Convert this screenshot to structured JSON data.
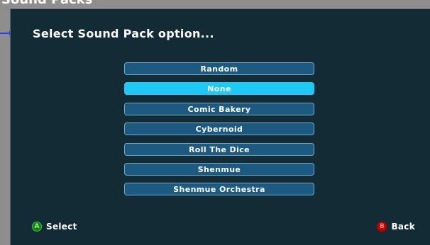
{
  "window": {
    "title": "Sound Packs"
  },
  "panel": {
    "header": "Select Sound Pack option..."
  },
  "options": [
    {
      "label": "Random",
      "selected": false
    },
    {
      "label": "None",
      "selected": true
    },
    {
      "label": "Comic Bakery",
      "selected": false
    },
    {
      "label": "Cybernoid",
      "selected": false
    },
    {
      "label": "Roll The Dice",
      "selected": false
    },
    {
      "label": "Shenmue",
      "selected": false
    },
    {
      "label": "Shenmue Orchestra",
      "selected": false
    }
  ],
  "footer": {
    "select_icon": "A",
    "select_label": "Select",
    "back_icon": "B",
    "back_label": "Back"
  },
  "colors": {
    "panel_bg": "#132b35",
    "option_bg": "#1c5a82",
    "option_selected_bg": "#1ec9f5",
    "a_button": "#1a7a1a",
    "b_button": "#c00000"
  }
}
